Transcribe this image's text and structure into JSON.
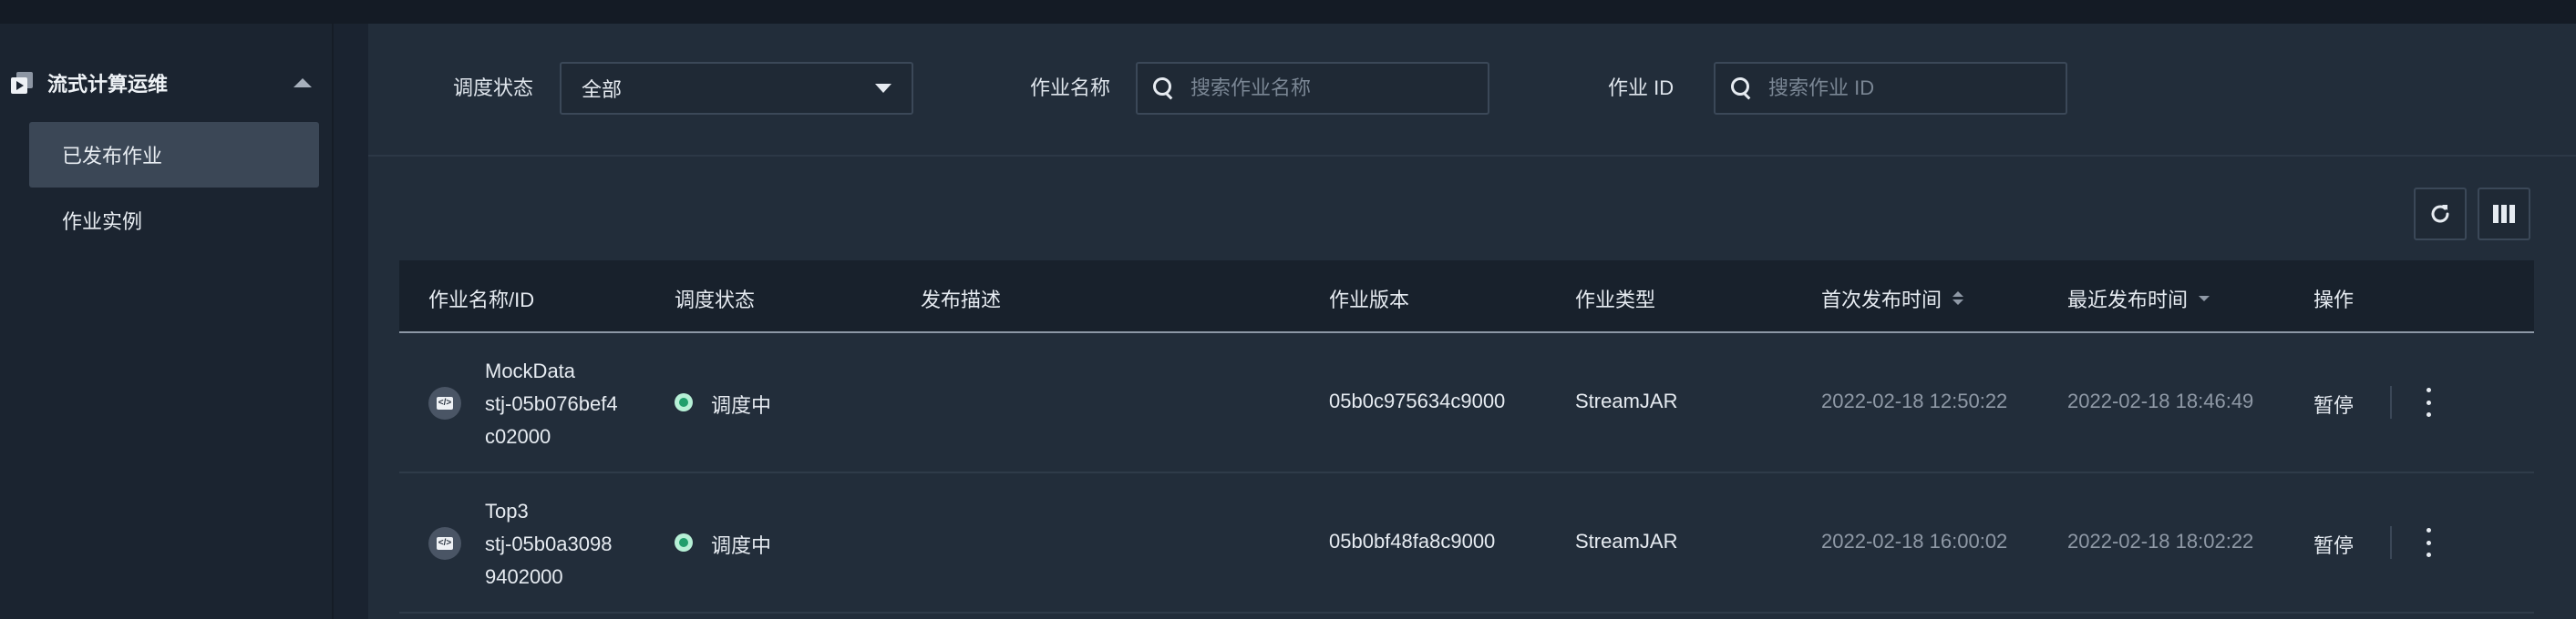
{
  "sidebar": {
    "group_label": "流式计算运维",
    "items": [
      {
        "label": "已发布作业",
        "active": true
      },
      {
        "label": "作业实例",
        "active": false
      }
    ]
  },
  "filters": {
    "schedule_status": {
      "label": "调度状态",
      "value": "全部"
    },
    "job_name": {
      "label": "作业名称",
      "placeholder": "搜索作业名称"
    },
    "job_id": {
      "label": "作业 ID",
      "placeholder": "搜索作业 ID"
    }
  },
  "toolbar": {
    "refresh_icon": "refresh-icon",
    "columns_icon": "columns-icon"
  },
  "table": {
    "headers": {
      "name_id": "作业名称/ID",
      "status": "调度状态",
      "description": "发布描述",
      "version": "作业版本",
      "type": "作业类型",
      "first_publish": "首次发布时间",
      "last_publish": "最近发布时间",
      "actions": "操作"
    },
    "rows": [
      {
        "name": "MockData",
        "id_line1": "stj-05b076bef4",
        "id_line2": "c02000",
        "status": "调度中",
        "description": "",
        "version": "05b0c975634c9000",
        "type": "StreamJAR",
        "first_publish": "2022-02-18 12:50:22",
        "last_publish": "2022-02-18 18:46:49",
        "action": "暂停"
      },
      {
        "name": "Top3",
        "id_line1": "stj-05b0a3098",
        "id_line2": "9402000",
        "status": "调度中",
        "description": "",
        "version": "05b0bf48fa8c9000",
        "type": "StreamJAR",
        "first_publish": "2022-02-18 16:00:02",
        "last_publish": "2022-02-18 18:02:22",
        "action": "暂停"
      }
    ]
  },
  "colors": {
    "status_running": "#1f9e6b",
    "active_item": "#3b4756"
  }
}
